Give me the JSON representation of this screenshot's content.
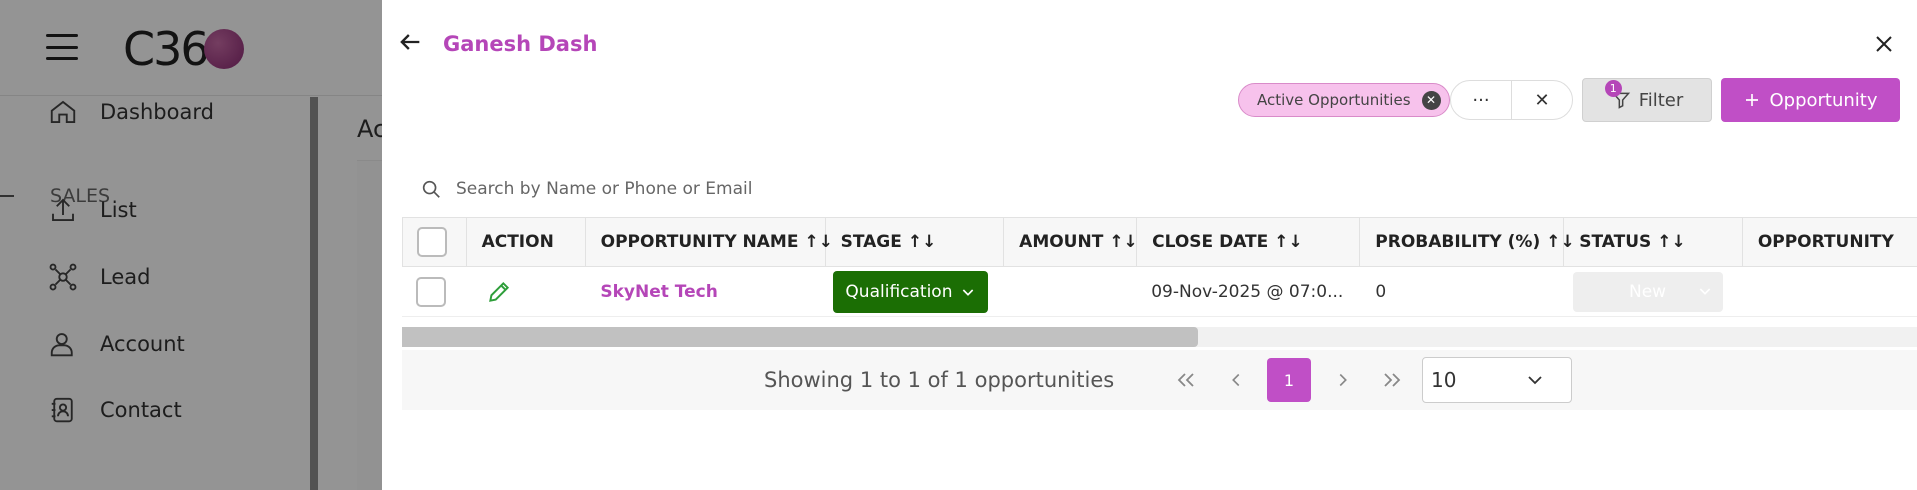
{
  "app": {
    "logo_text": "C36",
    "sidebar": {
      "items": [
        {
          "label": "Dashboard",
          "icon": "home-icon"
        },
        {
          "label": "List",
          "icon": "upload-icon"
        },
        {
          "label": "Lead",
          "icon": "network-icon"
        },
        {
          "label": "Account",
          "icon": "user-icon"
        },
        {
          "label": "Contact",
          "icon": "contact-book-icon"
        }
      ],
      "section_label": "SALES"
    },
    "main_crumb": "Ac"
  },
  "drawer": {
    "title": "Ganesh Dash",
    "chip_label": "Active Opportunities",
    "more_label": "···",
    "clear_label": "✕",
    "filter_label": "Filter",
    "filter_count": "1",
    "add_label": "Opportunity",
    "search_placeholder": "Search by Name or Phone or Email",
    "columns": [
      {
        "label": "ACTION",
        "sort": ""
      },
      {
        "label": "OPPORTUNITY NAME",
        "sort": "↑↓"
      },
      {
        "label": "STAGE",
        "sort": "↑↓"
      },
      {
        "label": "AMOUNT",
        "sort": "↑↓"
      },
      {
        "label": "CLOSE DATE",
        "sort": "↑↓"
      },
      {
        "label": "PROBABILITY (%)",
        "sort": "↑↓"
      },
      {
        "label": "STATUS",
        "sort": "↑↓"
      },
      {
        "label": "OPPORTUNITY",
        "sort": ""
      }
    ],
    "rows": [
      {
        "name": "SkyNet Tech",
        "stage": "Qualification",
        "amount": "",
        "close_date": "09-Nov-2025 @ 07:0...",
        "probability": "0",
        "status": "New"
      }
    ],
    "pagination": {
      "summary": "Showing 1 to 1 of 1 opportunities",
      "current_page": "1",
      "page_size": "10"
    }
  },
  "colors": {
    "accent": "#c04fc6",
    "stage_green": "#1b6e04"
  }
}
